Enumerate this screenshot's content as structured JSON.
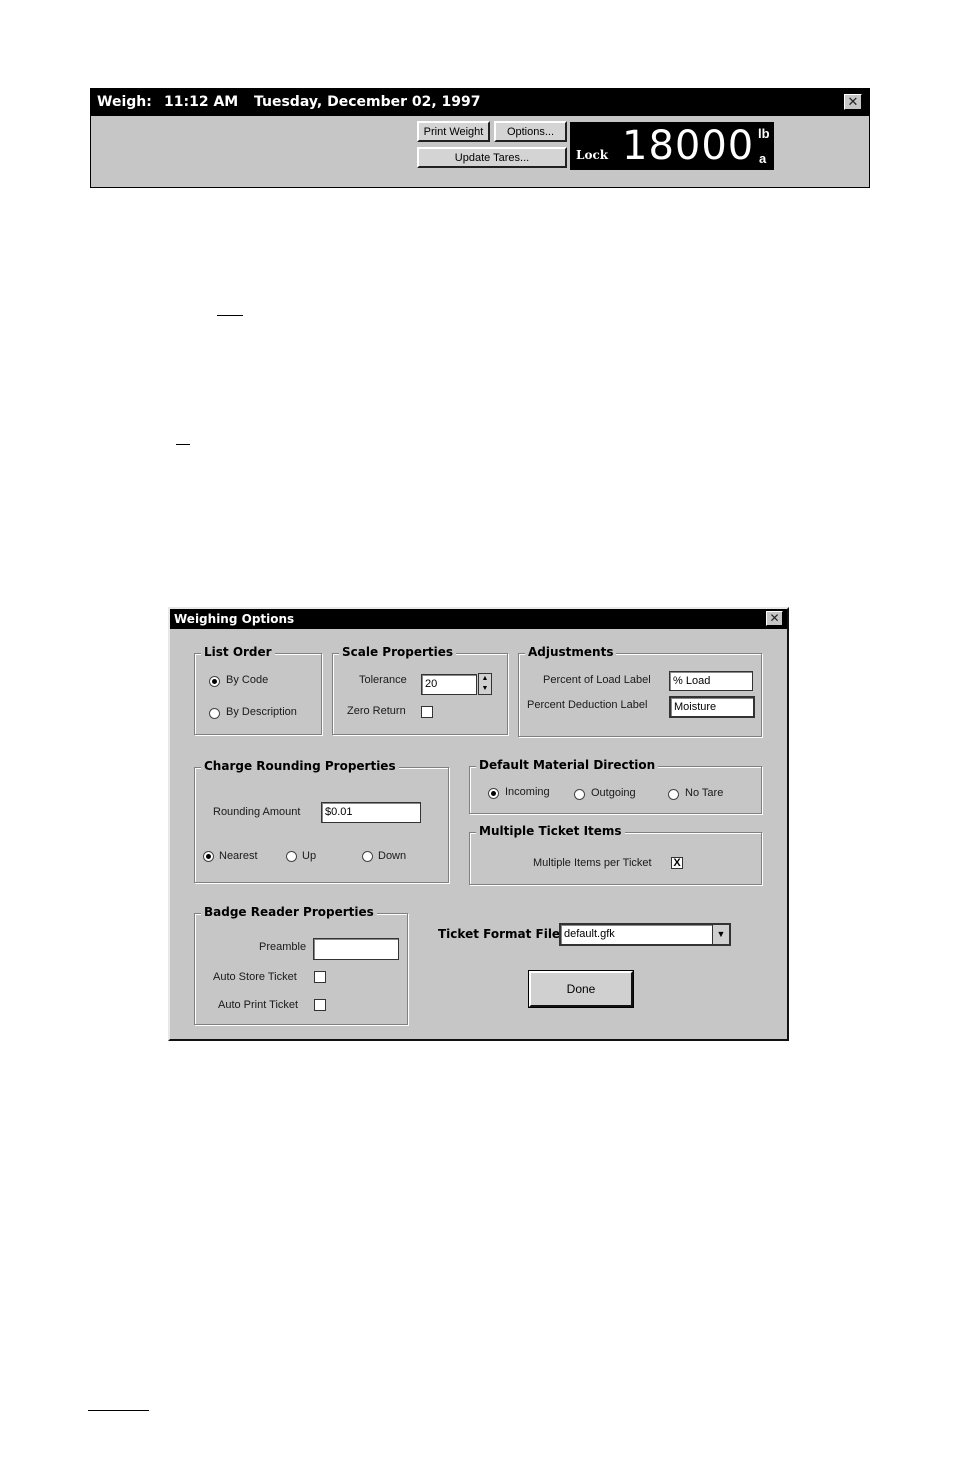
{
  "weigh_bar": {
    "title_label": "Weigh:",
    "time": "11:12 AM",
    "date": "Tuesday, December 02, 1997",
    "close_glyph": "✕",
    "print_weight_button": "Print Weight",
    "options_button": "Options...",
    "update_tares_button": "Update Tares...",
    "display": {
      "status": "Lock",
      "weight": "18000",
      "unit": "lb",
      "mode": "a"
    }
  },
  "dialog": {
    "title": "Weighing Options",
    "close_glyph": "✕",
    "list_order": {
      "label": "List Order",
      "options": [
        "By Code",
        "By Description"
      ],
      "selected": "By Code"
    },
    "scale_properties": {
      "label": "Scale Properties",
      "tolerance_label": "Tolerance",
      "tolerance_value": "20",
      "zero_return_label": "Zero Return",
      "zero_return_checked": false
    },
    "adjustments": {
      "label": "Adjustments",
      "percent_load_label": "Percent of Load Label",
      "percent_load_value": "% Load",
      "percent_deduction_label": "Percent Deduction Label",
      "percent_deduction_value": "Moisture"
    },
    "charge_rounding": {
      "label": "Charge Rounding Properties",
      "rounding_amount_label": "Rounding Amount",
      "rounding_amount_value": "$0.01",
      "options": [
        "Nearest",
        "Up",
        "Down"
      ],
      "selected": "Nearest"
    },
    "default_material_direction": {
      "label": "Default Material Direction",
      "options": [
        "Incoming",
        "Outgoing",
        "No Tare"
      ],
      "selected": "Incoming"
    },
    "multiple_ticket_items": {
      "label": "Multiple Ticket Items",
      "checkbox_label": "Multiple Items per Ticket",
      "checked": true,
      "check_glyph": "X"
    },
    "badge_reader": {
      "label": "Badge Reader Properties",
      "preamble_label": "Preamble",
      "preamble_value": "",
      "auto_store_label": "Auto Store Ticket",
      "auto_store_checked": false,
      "auto_print_label": "Auto Print Ticket",
      "auto_print_checked": false
    },
    "ticket_format": {
      "label": "Ticket Format File",
      "value": "default.gfk"
    },
    "done_button": "Done"
  },
  "icons": {
    "spin_up": "▲",
    "spin_down": "▼",
    "dropdown": "▼"
  }
}
